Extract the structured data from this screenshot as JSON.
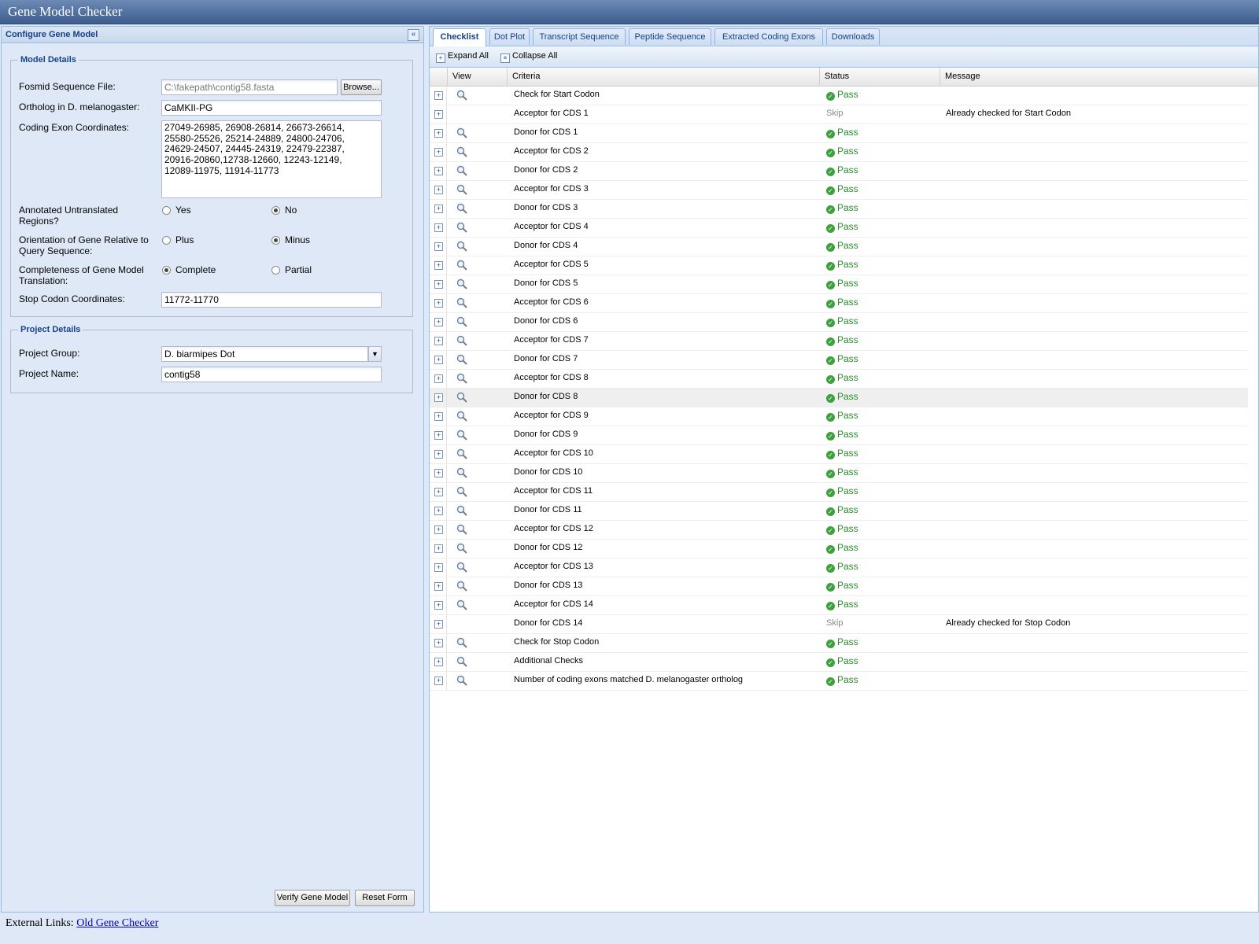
{
  "app": {
    "title": "Gene Model Checker"
  },
  "left_panel": {
    "title": "Configure Gene Model",
    "model_details": {
      "legend": "Model Details",
      "fosmid_label": "Fosmid Sequence File:",
      "fosmid_value": "C:\\fakepath\\contig58.fasta",
      "browse_label": "Browse...",
      "ortholog_label": "Ortholog in D. melanogaster:",
      "ortholog_value": "CaMKII-PG",
      "coords_label": "Coding Exon Coordinates:",
      "coords_value": "27049-26985, 26908-26814, 26673-26614,\n25580-25526, 25214-24889, 24800-24706,\n24629-24507, 24445-24319, 22479-22387,\n20916-20860,12738-12660, 12243-12149,\n12089-11975, 11914-11773",
      "utr_label": "Annotated Untranslated Regions?",
      "utr_options": [
        "Yes",
        "No"
      ],
      "utr_selected": "No",
      "orientation_label": "Orientation of Gene Relative to Query Sequence:",
      "orientation_options": [
        "Plus",
        "Minus"
      ],
      "orientation_selected": "Minus",
      "completeness_label": "Completeness of Gene Model Translation:",
      "completeness_options": [
        "Complete",
        "Partial"
      ],
      "completeness_selected": "Complete",
      "stop_label": "Stop Codon Coordinates:",
      "stop_value": "11772-11770"
    },
    "project_details": {
      "legend": "Project Details",
      "group_label": "Project Group:",
      "group_value": "D. biarmipes Dot",
      "name_label": "Project Name:",
      "name_value": "contig58"
    },
    "verify_label": "Verify Gene Model",
    "reset_label": "Reset Form"
  },
  "external_links": {
    "label": "External Links:",
    "link": "Old Gene Checker"
  },
  "tabs": [
    "Checklist",
    "Dot Plot",
    "Transcript Sequence",
    "Peptide Sequence",
    "Extracted Coding Exons",
    "Downloads"
  ],
  "active_tab": "Checklist",
  "toolbar": {
    "expand_label": "Expand All",
    "collapse_label": "Collapse All"
  },
  "columns": [
    "View",
    "Criteria",
    "Status",
    "Message"
  ],
  "rows": [
    {
      "criteria": "Check for Start Codon",
      "status": "Pass",
      "message": "",
      "view": true
    },
    {
      "criteria": "Acceptor for CDS 1",
      "status": "Skip",
      "message": "Already checked for Start Codon",
      "view": false
    },
    {
      "criteria": "Donor for CDS 1",
      "status": "Pass",
      "message": "",
      "view": true
    },
    {
      "criteria": "Acceptor for CDS 2",
      "status": "Pass",
      "message": "",
      "view": true
    },
    {
      "criteria": "Donor for CDS 2",
      "status": "Pass",
      "message": "",
      "view": true
    },
    {
      "criteria": "Acceptor for CDS 3",
      "status": "Pass",
      "message": "",
      "view": true
    },
    {
      "criteria": "Donor for CDS 3",
      "status": "Pass",
      "message": "",
      "view": true
    },
    {
      "criteria": "Acceptor for CDS 4",
      "status": "Pass",
      "message": "",
      "view": true
    },
    {
      "criteria": "Donor for CDS 4",
      "status": "Pass",
      "message": "",
      "view": true
    },
    {
      "criteria": "Acceptor for CDS 5",
      "status": "Pass",
      "message": "",
      "view": true
    },
    {
      "criteria": "Donor for CDS 5",
      "status": "Pass",
      "message": "",
      "view": true
    },
    {
      "criteria": "Acceptor for CDS 6",
      "status": "Pass",
      "message": "",
      "view": true
    },
    {
      "criteria": "Donor for CDS 6",
      "status": "Pass",
      "message": "",
      "view": true
    },
    {
      "criteria": "Acceptor for CDS 7",
      "status": "Pass",
      "message": "",
      "view": true
    },
    {
      "criteria": "Donor for CDS 7",
      "status": "Pass",
      "message": "",
      "view": true
    },
    {
      "criteria": "Acceptor for CDS 8",
      "status": "Pass",
      "message": "",
      "view": true
    },
    {
      "criteria": "Donor for CDS 8",
      "status": "Pass",
      "message": "",
      "view": true,
      "highlight": true
    },
    {
      "criteria": "Acceptor for CDS 9",
      "status": "Pass",
      "message": "",
      "view": true
    },
    {
      "criteria": "Donor for CDS 9",
      "status": "Pass",
      "message": "",
      "view": true
    },
    {
      "criteria": "Acceptor for CDS 10",
      "status": "Pass",
      "message": "",
      "view": true
    },
    {
      "criteria": "Donor for CDS 10",
      "status": "Pass",
      "message": "",
      "view": true
    },
    {
      "criteria": "Acceptor for CDS 11",
      "status": "Pass",
      "message": "",
      "view": true
    },
    {
      "criteria": "Donor for CDS 11",
      "status": "Pass",
      "message": "",
      "view": true
    },
    {
      "criteria": "Acceptor for CDS 12",
      "status": "Pass",
      "message": "",
      "view": true
    },
    {
      "criteria": "Donor for CDS 12",
      "status": "Pass",
      "message": "",
      "view": true
    },
    {
      "criteria": "Acceptor for CDS 13",
      "status": "Pass",
      "message": "",
      "view": true
    },
    {
      "criteria": "Donor for CDS 13",
      "status": "Pass",
      "message": "",
      "view": true
    },
    {
      "criteria": "Acceptor for CDS 14",
      "status": "Pass",
      "message": "",
      "view": true
    },
    {
      "criteria": "Donor for CDS 14",
      "status": "Skip",
      "message": "Already checked for Stop Codon",
      "view": false
    },
    {
      "criteria": "Check for Stop Codon",
      "status": "Pass",
      "message": "",
      "view": true
    },
    {
      "criteria": "Additional Checks",
      "status": "Pass",
      "message": "",
      "view": true
    },
    {
      "criteria": "Number of coding exons matched D. melanogaster ortholog",
      "status": "Pass",
      "message": "",
      "view": true
    }
  ],
  "colors": {
    "pass": "#2a8a2a",
    "skip": "#8a8a8a",
    "header": "#15428b"
  }
}
